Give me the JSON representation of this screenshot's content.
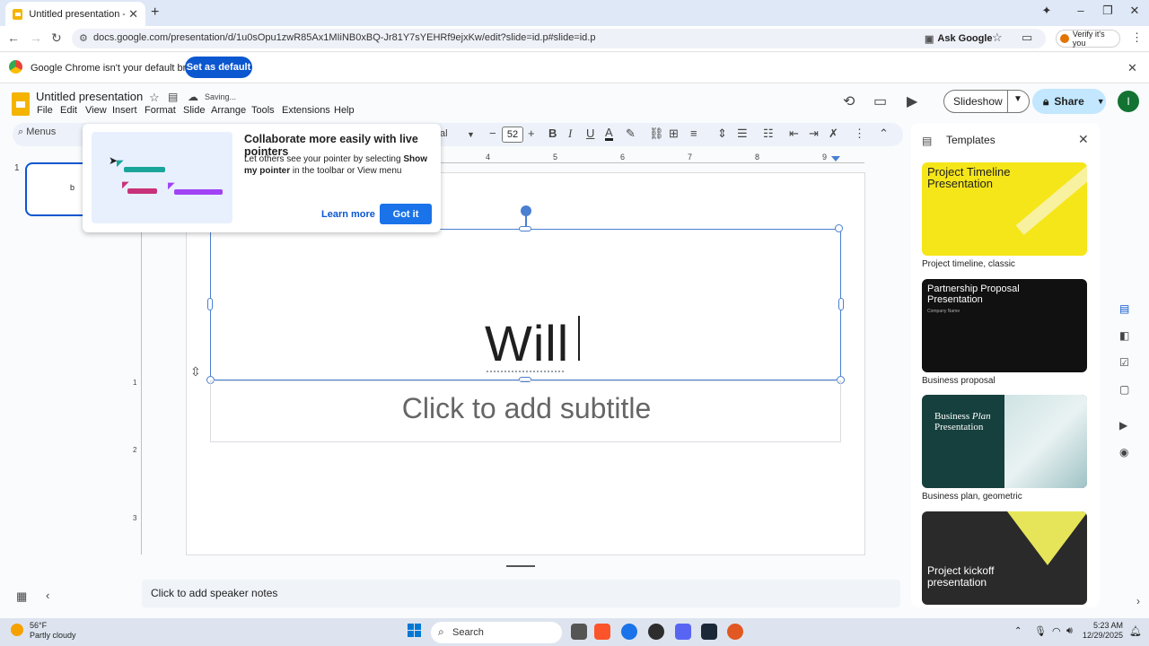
{
  "browser": {
    "tab_title": "Untitled presentation - Google",
    "url": "docs.google.com/presentation/d/1u0sOpu1zwR85Ax1MIiNB0xBQ-Jr81Y7sYEHRf9ejxKw/edit?slide=id.p#slide=id.p",
    "ask_google": "Ask Google",
    "verify": "Verify it's you",
    "infobar_text": "Google Chrome isn't your default browser",
    "set_default": "Set as default"
  },
  "doc": {
    "title": "Untitled presentation",
    "status": "Saving..."
  },
  "menu": [
    "File",
    "Edit",
    "View",
    "Insert",
    "Format",
    "Slide",
    "Arrange",
    "Tools",
    "Extensions",
    "Help"
  ],
  "header": {
    "slideshow": "Slideshow",
    "share": "Share",
    "avatar": "I"
  },
  "toolbar": {
    "menus": "Menus",
    "font_fragment": "al",
    "font_size": "52"
  },
  "filmstrip": {
    "slide_number": "1",
    "thumb_text": "b"
  },
  "ruler": {
    "h": [
      "4",
      "5",
      "6",
      "7",
      "8",
      "9"
    ],
    "v": [
      "1",
      "2",
      "3"
    ]
  },
  "slide": {
    "title": "Will",
    "subtitle_placeholder": "Click to add subtitle"
  },
  "notes": {
    "placeholder": "Click to add speaker notes"
  },
  "popup": {
    "title": "Collaborate more easily with live pointers",
    "body_pre": "Let others see your pointer by selecting ",
    "body_bold": "Show my pointer",
    "body_post": " in the toolbar or View menu",
    "learn_more": "Learn more",
    "got_it": "Got it"
  },
  "templates": {
    "heading": "Templates",
    "items": [
      {
        "card_title": "Project Timeline Presentation",
        "caption": "Project timeline, classic",
        "bg": "#f5e61a",
        "fg": "#1f1f1f"
      },
      {
        "card_title": "Partnership Proposal Presentation",
        "card_sub": "Company Name",
        "caption": "Business proposal",
        "bg": "#111111",
        "fg": "#ffffff"
      },
      {
        "card_title_a": "Business ",
        "card_title_b": "Plan",
        "card_title_c": "Presentation",
        "caption": "Business plan, geometric",
        "bg": "#16403d",
        "fg": "#ffffff"
      },
      {
        "card_title": "Project kickoff presentation",
        "caption": "",
        "bg": "#2a2a2a",
        "fg": "#ffffff"
      }
    ]
  },
  "taskbar": {
    "temp": "56°F",
    "weather": "Partly cloudy",
    "search": "Search",
    "time": "5:23 AM",
    "date": "12/29/2025"
  },
  "colors": {
    "accent": "#0b57d0",
    "selection": "#4a7fd1",
    "slides_yellow": "#f4b400"
  }
}
